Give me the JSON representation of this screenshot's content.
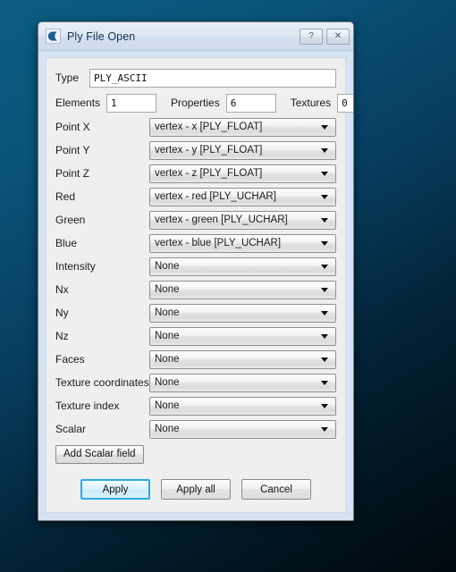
{
  "window": {
    "title": "Ply File Open",
    "icon": "cloudcompare-logo-icon",
    "help_button": "?",
    "close_button": "✕"
  },
  "form": {
    "type": {
      "label": "Type",
      "value": "PLY_ASCII"
    },
    "counts": [
      {
        "label": "Elements",
        "value": "1"
      },
      {
        "label": "Properties",
        "value": "6"
      },
      {
        "label": "Textures",
        "value": "0"
      }
    ],
    "mappings": [
      {
        "label": "Point X",
        "value": "vertex - x [PLY_FLOAT]"
      },
      {
        "label": "Point Y",
        "value": "vertex - y [PLY_FLOAT]"
      },
      {
        "label": "Point Z",
        "value": "vertex - z [PLY_FLOAT]"
      },
      {
        "label": "Red",
        "value": "vertex - red [PLY_UCHAR]"
      },
      {
        "label": "Green",
        "value": "vertex - green [PLY_UCHAR]"
      },
      {
        "label": "Blue",
        "value": "vertex - blue [PLY_UCHAR]"
      },
      {
        "label": "Intensity",
        "value": "None"
      },
      {
        "label": "Nx",
        "value": "None"
      },
      {
        "label": "Ny",
        "value": "None"
      },
      {
        "label": "Nz",
        "value": "None"
      },
      {
        "label": "Faces",
        "value": "None"
      },
      {
        "label": "Texture coordinates",
        "value": "None"
      },
      {
        "label": "Texture index",
        "value": "None"
      },
      {
        "label": "Scalar",
        "value": "None"
      }
    ],
    "add_scalar_label": "Add Scalar field"
  },
  "buttons": {
    "apply": "Apply",
    "apply_all": "Apply all",
    "cancel": "Cancel"
  },
  "colors": {
    "desktop_top": "#0c5b84",
    "desktop_bottom": "#00080d",
    "dialog_frame": "#d6e3f2",
    "panel": "#efefef",
    "default_button_accent": "#29abe2",
    "icon_blue": "#1f5c8f"
  }
}
